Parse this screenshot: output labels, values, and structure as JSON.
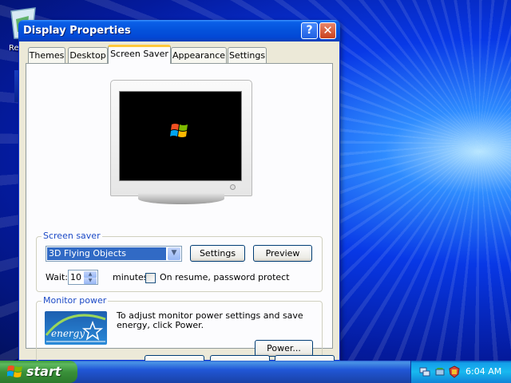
{
  "desktop": {
    "icon_label": "Re",
    "icons": {
      "bin": "recycle-bin-icon",
      "pointer": "mouse-pointer-icon"
    }
  },
  "window": {
    "title": "Display Properties",
    "help_glyph": "?",
    "close_glyph": "✕",
    "tabs": [
      {
        "label": "Themes",
        "active": false
      },
      {
        "label": "Desktop",
        "active": false
      },
      {
        "label": "Screen Saver",
        "active": true
      },
      {
        "label": "Appearance",
        "active": false
      },
      {
        "label": "Settings",
        "active": false
      }
    ]
  },
  "screen_saver": {
    "group_label": "Screen saver",
    "selected": "3D Flying Objects",
    "settings_label": "Settings",
    "preview_label": "Preview",
    "wait_label": "Wait:",
    "wait_value": "10",
    "minutes_label": "minutes",
    "password_label": "On resume, password protect",
    "password_checked": false
  },
  "monitor_power": {
    "group_label": "Monitor power",
    "description": "To adjust monitor power settings and save energy, click Power.",
    "power_label": "Power...",
    "logo_text": "energy"
  },
  "taskbar": {
    "start_label": "start",
    "clock": "6:04 AM",
    "tray_icons": [
      "network-icon",
      "safely-remove-icon",
      "security-alert-icon"
    ]
  },
  "colors": {
    "title_bar": "#0453dc",
    "selection": "#316ac5",
    "group_label": "#1c4ac6",
    "start_green": "#3a913a",
    "tab_highlight": "#ffc83c"
  }
}
